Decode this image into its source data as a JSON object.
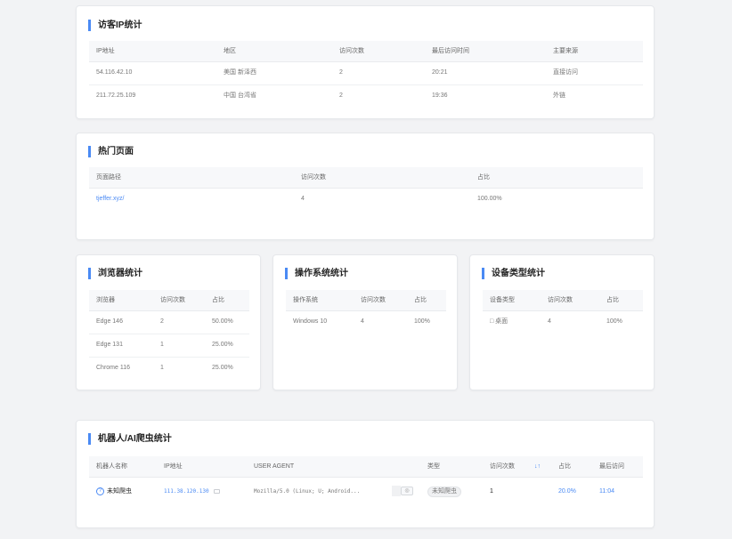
{
  "visitor_ip": {
    "title": "访客IP统计",
    "headers": [
      "IP地址",
      "地区",
      "访问次数",
      "最后访问时间",
      "主要来源"
    ],
    "rows": [
      [
        "54.116.42.10",
        "美国 新泽西",
        "2",
        "20:21",
        "直接访问"
      ],
      [
        "211.72.25.109",
        "中国 台湾省",
        "2",
        "19:36",
        "外链"
      ]
    ]
  },
  "hot_pages": {
    "title": "热门页面",
    "headers": [
      "页面路径",
      "访问次数",
      "占比"
    ],
    "rows": [
      [
        "tjeffer.xyz/",
        "4",
        "100.00%"
      ]
    ]
  },
  "browsers": {
    "title": "浏览器统计",
    "headers": [
      "浏览器",
      "访问次数",
      "占比"
    ],
    "rows": [
      [
        "Edge 146",
        "2",
        "50.00%"
      ],
      [
        "Edge 131",
        "1",
        "25.00%"
      ],
      [
        "Chrome 116",
        "1",
        "25.00%"
      ]
    ]
  },
  "os": {
    "title": "操作系统统计",
    "headers": [
      "操作系统",
      "访问次数",
      "占比"
    ],
    "rows": [
      [
        "Windows 10",
        "4",
        "100%"
      ]
    ]
  },
  "devices": {
    "title": "设备类型统计",
    "headers": [
      "设备类型",
      "访问次数",
      "占比"
    ],
    "rows": [
      [
        "□ 桌面",
        "4",
        "100%"
      ]
    ]
  },
  "bots": {
    "title": "机器人/AI爬虫统计",
    "headers": [
      "机器人名称",
      "IP地址",
      "USER AGENT",
      "类型",
      "访问次数",
      "占比",
      "最后访问"
    ],
    "sort_icon": "↓↑",
    "rows": [
      {
        "icon": "?",
        "name": "未知爬虫",
        "ip": "111.38.120.130",
        "ua": "Mozilla/5.0 (Linux; U; Android...",
        "type": "未知爬虫",
        "visits": "1",
        "share": "20.0%",
        "last": "11:04"
      }
    ]
  },
  "colors": {
    "accent": "#4a8af4",
    "background": "#f2f3f5"
  }
}
